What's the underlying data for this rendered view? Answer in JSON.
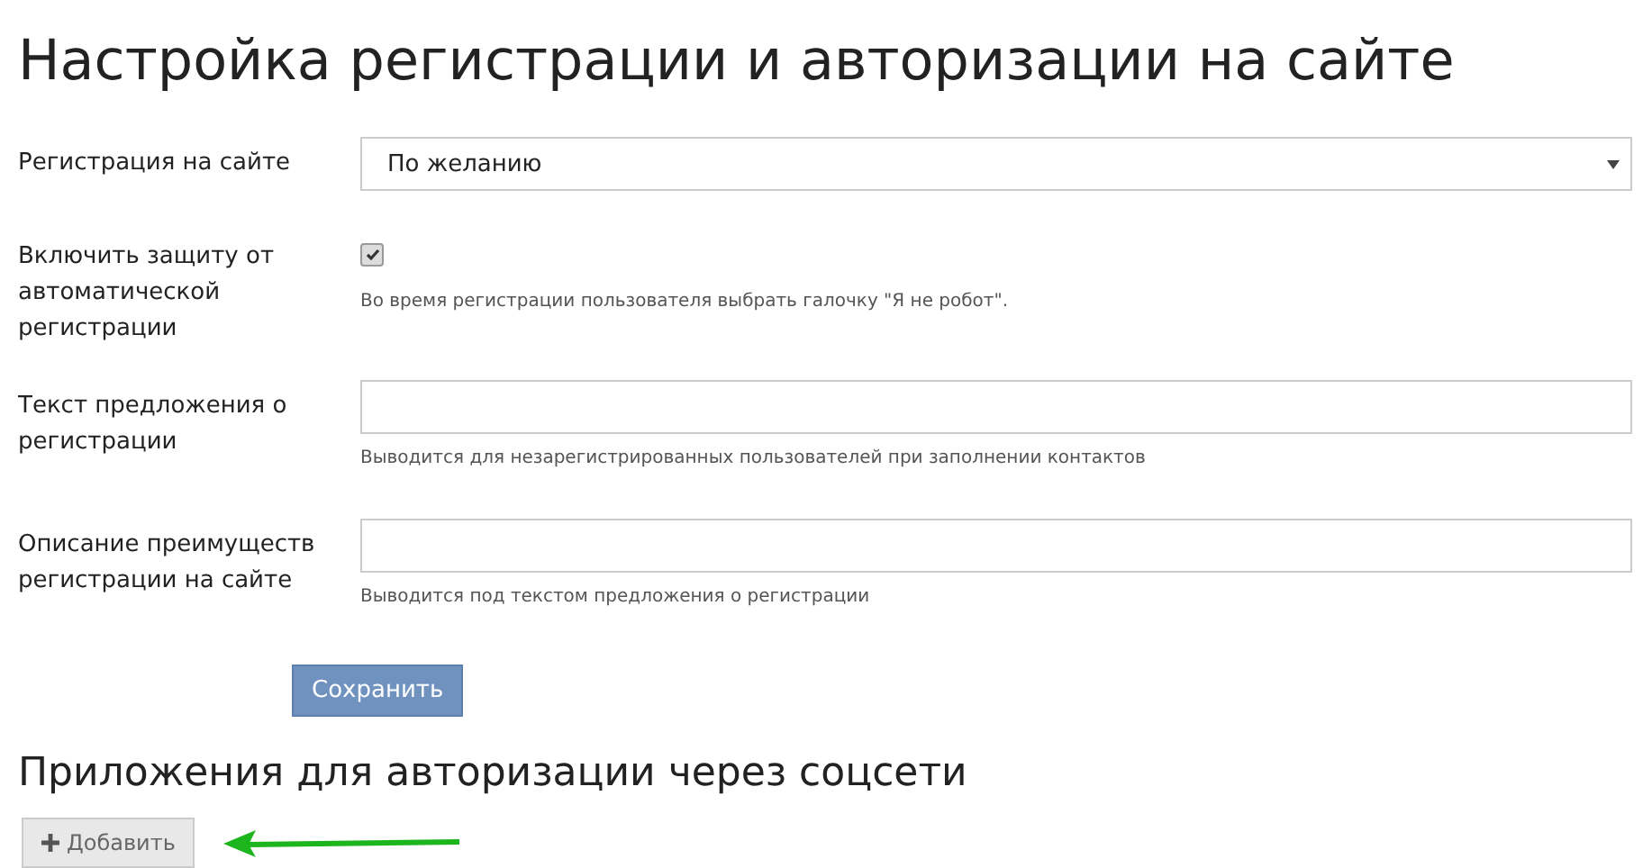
{
  "title": "Настройка регистрации и авторизации на сайте",
  "fields": [
    {
      "kind": "select",
      "label": "Регистрация на сайте",
      "value": "По желанию"
    },
    {
      "kind": "checkbox",
      "label": "Включить защиту от автоматической регистрации",
      "checked": true,
      "hint": "Во время регистрации пользователя выбрать галочку \"Я не робот\"."
    },
    {
      "kind": "text",
      "label": "Текст предложения о регистрации",
      "hint": "Выводится для незарегистрированных пользователей при заполнении контактов"
    },
    {
      "kind": "text",
      "label": "Описание преимуществ регистрации на сайте",
      "hint": "Выводится под текстом предложения о регистрации"
    }
  ],
  "save_button": "Сохранить",
  "apps_section": {
    "title": "Приложения для авторизации через соцсети",
    "add_button": "Добавить"
  }
}
